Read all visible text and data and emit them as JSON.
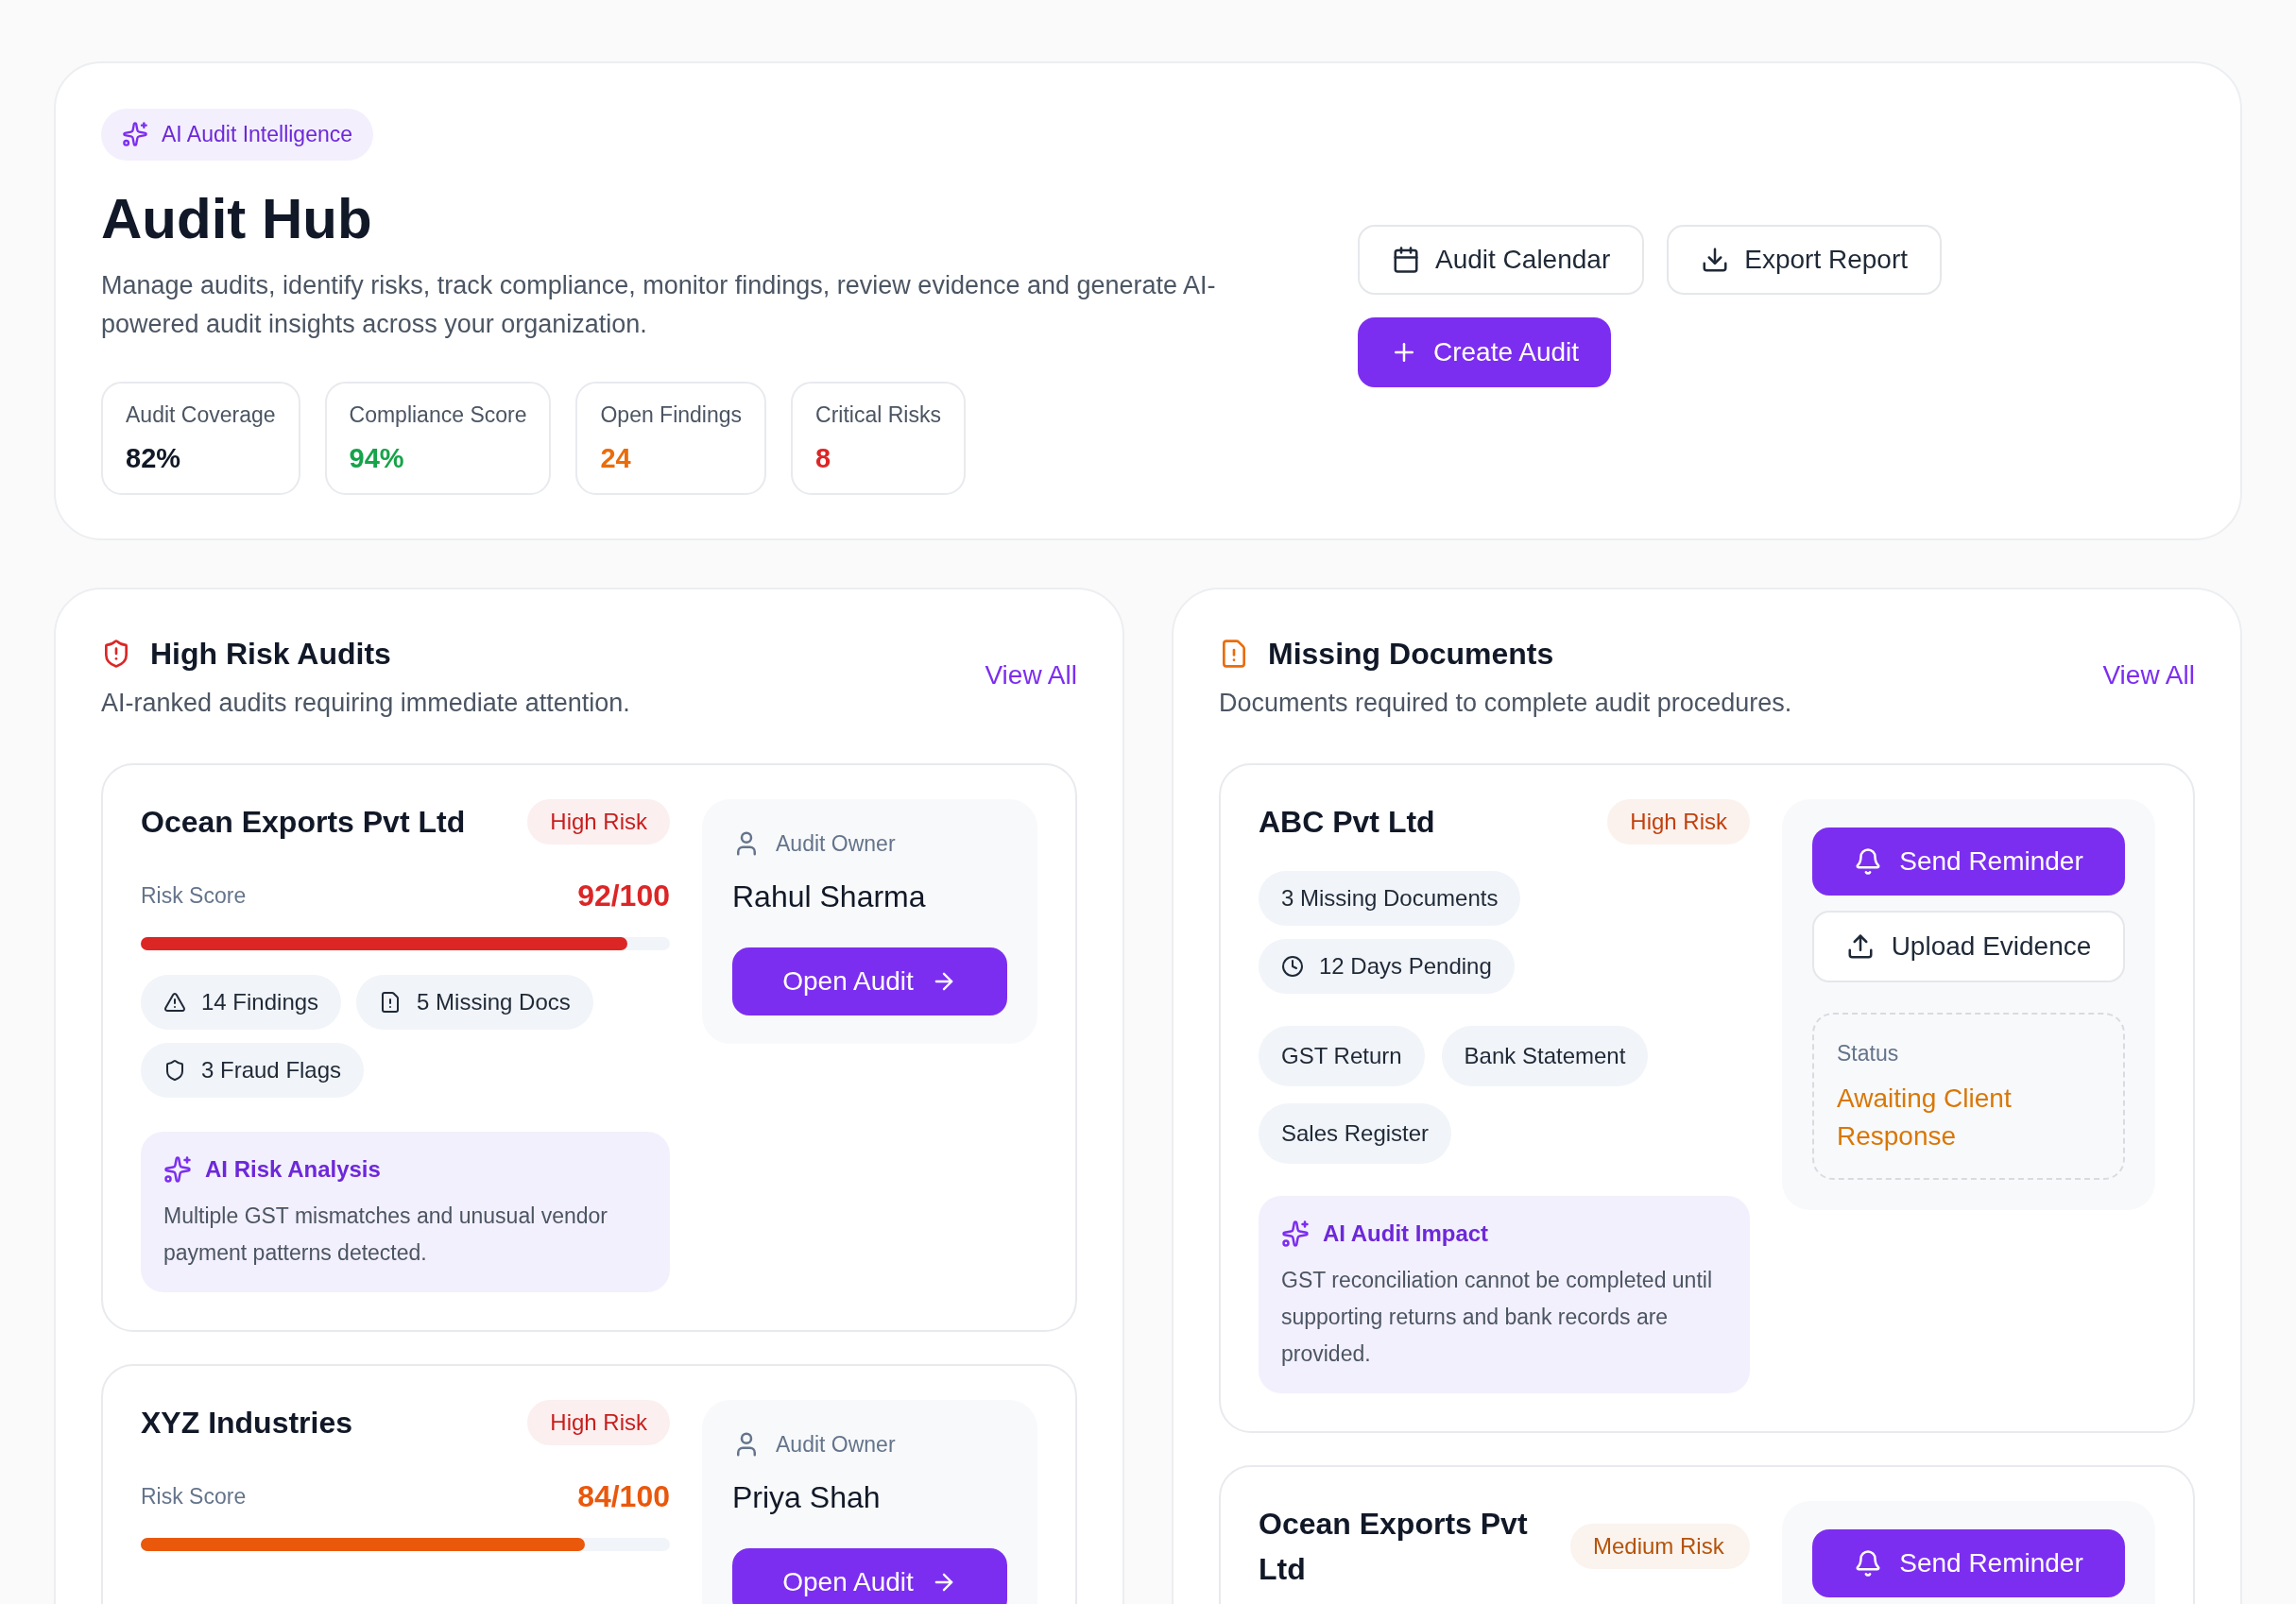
{
  "header": {
    "badge": "AI Audit Intelligence",
    "title": "Audit Hub",
    "description": "Manage audits, identify risks, track compliance, monitor findings, review evidence and generate AI-powered audit insights across your organization.",
    "stats": [
      {
        "label": "Audit Coverage",
        "value": "82%",
        "color": "#111827"
      },
      {
        "label": "Compliance Score",
        "value": "94%",
        "color": "#16a34a"
      },
      {
        "label": "Open Findings",
        "value": "24",
        "color": "#ea6c0a"
      },
      {
        "label": "Critical Risks",
        "value": "8",
        "color": "#dc2626"
      }
    ],
    "buttons": [
      {
        "kind": "calendar",
        "label": "Audit Calendar"
      },
      {
        "kind": "export",
        "label": "Export Report"
      },
      {
        "kind": "create",
        "label": "Create Audit"
      }
    ]
  },
  "high_risk_audits": {
    "title": "High Risk Audits",
    "subtitle": "AI-ranked audits requiring immediate attention.",
    "link": "View All",
    "items": [
      {
        "company": "Ocean Exports Pvt Ltd",
        "risk": {
          "text": "High Risk",
          "color": "#c81e1e"
        },
        "score_label": "Risk Score",
        "score": "92/100",
        "color": "#dc2626",
        "level": 0.92,
        "chips": [
          {
            "kind": "findings",
            "text": "14 Findings"
          },
          {
            "kind": "docs",
            "text": "5 Missing Docs"
          },
          {
            "kind": "fraud",
            "text": "3 Fraud Flags"
          }
        ],
        "analysis": {
          "title": "AI Risk Analysis",
          "text": "Multiple GST mismatches and unusual vendor payment patterns detected."
        },
        "owner_label": "Audit Owner",
        "owner": "Rahul Sharma",
        "action": "Open Audit"
      },
      {
        "company": "XYZ Industries",
        "risk": {
          "text": "High Risk",
          "color": "#c81e1e"
        },
        "score_label": "Risk Score",
        "score": "84/100",
        "color": "#ea580c",
        "level": 0.84,
        "owner_label": "Audit Owner",
        "owner": "Priya Shah",
        "action": "Open Audit"
      }
    ]
  },
  "missing_documents": {
    "title": "Missing Documents",
    "subtitle": "Documents required to complete audit procedures.",
    "link": "View All",
    "items": [
      {
        "company": "ABC Pvt Ltd",
        "risk": {
          "text": "High Risk",
          "color": "#c2410c"
        },
        "tags": [
          {
            "kind": "count",
            "text": "3 Missing Documents"
          },
          {
            "kind": "pending",
            "text": "12 Days Pending"
          }
        ],
        "documents": [
          "GST Return",
          "Bank Statement",
          "Sales Register"
        ],
        "impact": {
          "title": "AI Audit Impact",
          "text": "GST reconciliation cannot be completed until supporting returns and bank records are provided."
        },
        "actions": [
          {
            "kind": "remind",
            "label": "Send Reminder"
          },
          {
            "kind": "upload",
            "label": "Upload Evidence"
          }
        ],
        "status": {
          "label": "Status",
          "value": "Awaiting Client Response"
        }
      },
      {
        "company": "Ocean Exports Pvt Ltd",
        "risk": {
          "text": "Medium Risk",
          "color": "#b45309"
        },
        "actions": [
          {
            "kind": "remind",
            "label": "Send Reminder"
          }
        ]
      }
    ]
  }
}
